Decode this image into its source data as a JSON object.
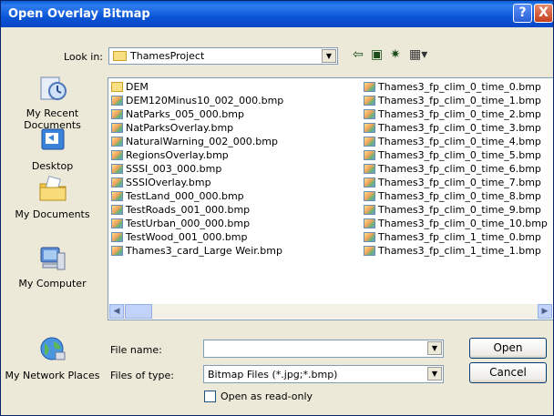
{
  "window": {
    "title": "Open Overlay Bitmap",
    "help_label": "?",
    "close_label": "X"
  },
  "look_in": {
    "label": "Look in:",
    "value": "ThamesProject"
  },
  "toolbar": {
    "back_icon": "back-arrow-icon",
    "up_icon": "up-folder-icon",
    "new_folder_icon": "new-folder-icon",
    "views_icon": "views-menu-icon"
  },
  "places": [
    {
      "label": "My Recent Documents",
      "icon": "recent-documents-icon"
    },
    {
      "label": "Desktop",
      "icon": "desktop-icon"
    },
    {
      "label": "My Documents",
      "icon": "my-documents-icon"
    },
    {
      "label": "My Computer",
      "icon": "my-computer-icon"
    },
    {
      "label": "My Network Places",
      "icon": "network-places-icon"
    }
  ],
  "files_left": [
    {
      "name": "DEM",
      "type": "folder"
    },
    {
      "name": "DEM120Minus10_002_000.bmp",
      "type": "bmp"
    },
    {
      "name": "NatParks_005_000.bmp",
      "type": "bmp"
    },
    {
      "name": "NatParksOverlay.bmp",
      "type": "bmp"
    },
    {
      "name": "NaturalWarning_002_000.bmp",
      "type": "bmp"
    },
    {
      "name": "RegionsOverlay.bmp",
      "type": "bmp"
    },
    {
      "name": "SSSI_003_000.bmp",
      "type": "bmp"
    },
    {
      "name": "SSSIOverlay.bmp",
      "type": "bmp"
    },
    {
      "name": "TestLand_000_000.bmp",
      "type": "bmp"
    },
    {
      "name": "TestRoads_001_000.bmp",
      "type": "bmp"
    },
    {
      "name": "TestUrban_000_000.bmp",
      "type": "bmp"
    },
    {
      "name": "TestWood_001_000.bmp",
      "type": "bmp"
    },
    {
      "name": "Thames3_card_Large Weir.bmp",
      "type": "bmp"
    }
  ],
  "files_right": [
    {
      "name": "Thames3_fp_clim_0_time_0.bmp",
      "type": "bmp"
    },
    {
      "name": "Thames3_fp_clim_0_time_1.bmp",
      "type": "bmp"
    },
    {
      "name": "Thames3_fp_clim_0_time_2.bmp",
      "type": "bmp"
    },
    {
      "name": "Thames3_fp_clim_0_time_3.bmp",
      "type": "bmp"
    },
    {
      "name": "Thames3_fp_clim_0_time_4.bmp",
      "type": "bmp"
    },
    {
      "name": "Thames3_fp_clim_0_time_5.bmp",
      "type": "bmp"
    },
    {
      "name": "Thames3_fp_clim_0_time_6.bmp",
      "type": "bmp"
    },
    {
      "name": "Thames3_fp_clim_0_time_7.bmp",
      "type": "bmp"
    },
    {
      "name": "Thames3_fp_clim_0_time_8.bmp",
      "type": "bmp"
    },
    {
      "name": "Thames3_fp_clim_0_time_9.bmp",
      "type": "bmp"
    },
    {
      "name": "Thames3_fp_clim_0_time_10.bmp",
      "type": "bmp"
    },
    {
      "name": "Thames3_fp_clim_1_time_0.bmp",
      "type": "bmp"
    },
    {
      "name": "Thames3_fp_clim_1_time_1.bmp",
      "type": "bmp"
    }
  ],
  "file_name": {
    "label": "File name:",
    "value": ""
  },
  "file_type": {
    "label": "Files of type:",
    "value": "Bitmap Files (*.jpg;*.bmp)"
  },
  "read_only": {
    "label": "Open as read-only",
    "checked": false
  },
  "buttons": {
    "open": "Open",
    "cancel": "Cancel"
  },
  "colors": {
    "titlebar": "#0b56d6",
    "dialog_bg": "#ece9d8",
    "close": "#c43f1e"
  }
}
